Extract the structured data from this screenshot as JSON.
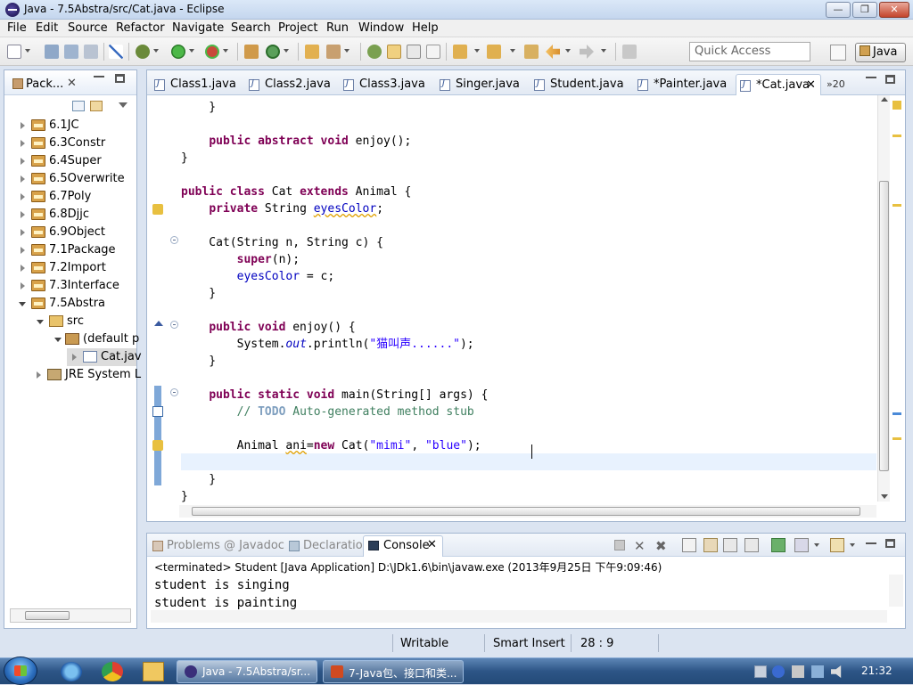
{
  "window": {
    "title": "Java - 7.5Abstra/src/Cat.java - Eclipse"
  },
  "menu": [
    "File",
    "Edit",
    "Source",
    "Refactor",
    "Navigate",
    "Search",
    "Project",
    "Run",
    "Window",
    "Help"
  ],
  "toolbar": {
    "quick_access": "Quick Access",
    "perspective": "Java"
  },
  "package_explorer": {
    "tab_label": "Pack...",
    "close": "✕",
    "tree": [
      {
        "label": "6.1JC"
      },
      {
        "label": "6.3Constr"
      },
      {
        "label": "6.4Super"
      },
      {
        "label": "6.5Overwrite"
      },
      {
        "label": "6.7Poly"
      },
      {
        "label": "6.8Djjc"
      },
      {
        "label": "6.9Object"
      },
      {
        "label": "7.1Package"
      },
      {
        "label": "7.2Import"
      },
      {
        "label": "7.3Interface"
      },
      {
        "label": "7.5Abstra"
      },
      {
        "label": "src"
      },
      {
        "label": "(default p"
      },
      {
        "label": "Cat.jav"
      },
      {
        "label": "JRE System L"
      }
    ]
  },
  "editor": {
    "tabs": [
      {
        "label": "Class1.java"
      },
      {
        "label": "Class2.java"
      },
      {
        "label": "Class3.java"
      },
      {
        "label": "Singer.java"
      },
      {
        "label": "Student.java"
      },
      {
        "label": "*Painter.java"
      },
      {
        "label": "*Cat.java"
      }
    ],
    "tab_close": "✕",
    "more_tabs": "»20",
    "code": {
      "l1": "    }",
      "l2_kw": "public abstract void",
      "l2_rest": " enjoy();",
      "l3": "}",
      "l4_kw1": "public class",
      "l4_mid": " Cat ",
      "l4_kw2": "extends",
      "l4_rest": " Animal {",
      "l5_kw": "private",
      "l5_type": " String ",
      "l5_field": "eyesColor",
      "l5_end": ";",
      "l6": "    Cat(String n, String c) {",
      "l7_kw": "super",
      "l7_rest": "(n);",
      "l8_field": "eyesColor",
      "l8_rest": " = c;",
      "l9": "    }",
      "l10_kw": "public void",
      "l10_rest": " enjoy() {",
      "l11_a": "System.",
      "l11_out": "out",
      "l11_b": ".println(",
      "l11_str": "\"猫叫声......\"",
      "l11_c": ");",
      "l12": "    }",
      "l13_kw": "public static void",
      "l13_rest": " main(String[] args) {",
      "l14_a": "// ",
      "l14_todo": "TODO",
      "l14_b": " Auto-generated method stub",
      "l15_a": "Animal ",
      "l15_var": "ani",
      "l15_b": "=",
      "l15_kw": "new",
      "l15_c": " Cat(",
      "l15_s1": "\"mimi\"",
      "l15_d": ", ",
      "l15_s2": "\"blue\"",
      "l15_e": ");",
      "l17": "    }",
      "l18": "}"
    }
  },
  "console": {
    "tabs": [
      {
        "label": "Problems"
      },
      {
        "label": "@ Javadoc"
      },
      {
        "label": "Declaration"
      },
      {
        "label": "Console"
      }
    ],
    "tab_close": "✕",
    "status": "<terminated> Student [Java Application] D:\\JDk1.6\\bin\\javaw.exe (2013年9月25日 下午9:09:46)",
    "output": [
      "student is singing",
      "student is painting"
    ]
  },
  "statusbar": {
    "mode": "Writable",
    "insert": "Smart Insert",
    "position": "28 : 9"
  },
  "taskbar": {
    "tasks": [
      {
        "label": "Java - 7.5Abstra/sr..."
      },
      {
        "label": "7-Java包、接口和类..."
      }
    ],
    "clock": "21:32"
  }
}
